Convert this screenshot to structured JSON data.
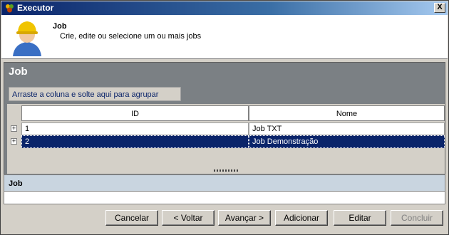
{
  "window": {
    "title": "Executor",
    "close_label": "X"
  },
  "header": {
    "title": "Job",
    "subtitle": "Crie, edite ou selecione um ou mais jobs"
  },
  "panel": {
    "title": "Job",
    "group_hint": "Arraste a coluna e solte aqui para agrupar"
  },
  "grid": {
    "columns": [
      "ID",
      "Nome"
    ],
    "rows": [
      {
        "id": "1",
        "nome": "Job TXT",
        "expander": "+"
      },
      {
        "id": "2",
        "nome": "Job Demonstração",
        "expander": "+"
      }
    ],
    "selected_row_index": 1
  },
  "detail": {
    "title": "Job"
  },
  "buttons": {
    "cancel": "Cancelar",
    "back": "< Voltar",
    "next": "Avançar >",
    "add": "Adicionar",
    "edit": "Editar",
    "finish": "Concluir"
  },
  "colors": {
    "selection": "#0a246a",
    "panel": "#7b8084",
    "titlebar": "#0a246a"
  }
}
